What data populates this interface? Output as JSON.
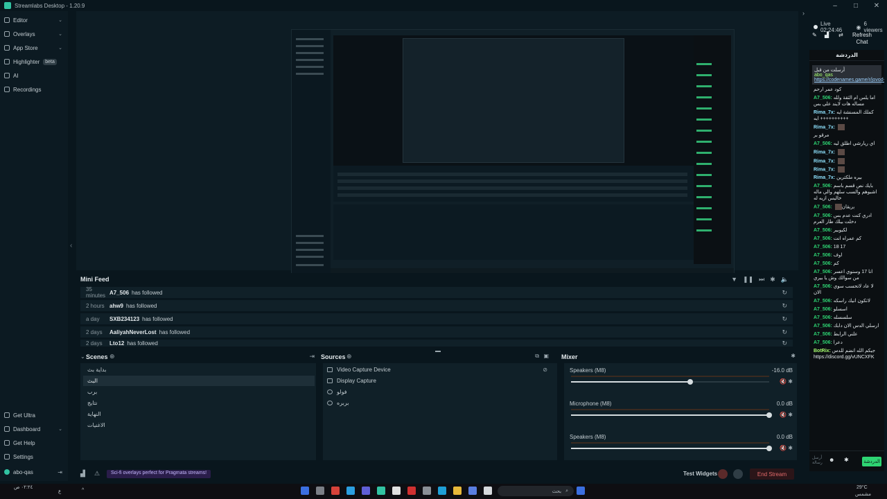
{
  "app": {
    "title": "Streamlabs Desktop - 1.20.9"
  },
  "sidebar": {
    "items": [
      {
        "label": "Editor",
        "chevron": "⌄"
      },
      {
        "label": "Overlays",
        "chevron": "⌄"
      },
      {
        "label": "App Store",
        "chevron": "⌄"
      },
      {
        "label": "Highlighter",
        "badge": "beta"
      },
      {
        "label": "AI"
      },
      {
        "label": "Recordings"
      }
    ],
    "bottom": [
      {
        "label": "Get Ultra"
      },
      {
        "label": "Dashboard",
        "chevron": "⌄"
      },
      {
        "label": "Get Help"
      },
      {
        "label": "Settings"
      }
    ],
    "user": {
      "name": "abo-qas"
    }
  },
  "mini_feed": {
    "title": "Mini Feed",
    "rows": [
      {
        "time": "35 minutes",
        "name": "A7_506",
        "action": "has followed"
      },
      {
        "time": "2 hours",
        "name": "ahw9",
        "action": "has followed"
      },
      {
        "time": "a day",
        "name": "SXB234123",
        "action": "has followed"
      },
      {
        "time": "2 days",
        "name": "AaliyahNeverLost",
        "action": "has followed"
      },
      {
        "time": "2 days",
        "name": "Lto12",
        "action": "has followed"
      }
    ]
  },
  "scenes": {
    "title": "Scenes",
    "items": [
      "بداية بث",
      "البث",
      "برب",
      "نتايج",
      "النهاية",
      "الاغنيات"
    ],
    "active_index": 1
  },
  "sources": {
    "title": "Sources",
    "items": [
      {
        "label": "Video Capture Device",
        "icon": "camera-icon"
      },
      {
        "label": "Display Capture",
        "icon": "monitor-icon"
      },
      {
        "label": "فولو",
        "icon": "globe-icon"
      },
      {
        "label": "بربره",
        "icon": "globe-icon"
      }
    ]
  },
  "mixer": {
    "title": "Mixer",
    "channels": [
      {
        "name": "Speakers (M8)",
        "db": "-16.0 dB",
        "level": 0.6
      },
      {
        "name": "Microphone (M8)",
        "db": "0.0 dB",
        "level": 1.0
      },
      {
        "name": "Speakers (M8)",
        "db": "0.0 dB",
        "level": 1.0
      }
    ]
  },
  "footer": {
    "alert": "Sci-fi overlays perfect for Pragmata streams!",
    "test_widgets": "Test Widgets",
    "end_stream": "End Stream"
  },
  "chat": {
    "live_time": "Live 02:24:46",
    "viewers": "6 viewers",
    "refresh": "Refresh Chat",
    "header": "الدردشة",
    "pinned_user": "abo_qas",
    "pinned_text": "أرسلت من قبل",
    "pinned_link": "https://codenames.game/r/jovod-...",
    "messages": [
      {
        "user": "",
        "text": "كود عمر ارحم"
      },
      {
        "user": "A7_506:",
        "text": "اما يلس ام الثقة ولله مساله هات لايند على بس",
        "cls": ""
      },
      {
        "user": "Rima_7x:",
        "text": "كملك المسنشة ايه ايه ++++++++++",
        "cls": "r"
      },
      {
        "user": "Rima_7x:",
        "text": "",
        "cls": "r",
        "emote": true
      },
      {
        "user": "",
        "text": "مرقو بر"
      },
      {
        "user": "A7_506:",
        "text": "اي ريارشي اطلق ليه",
        "cls": ""
      },
      {
        "user": "Rima_7x:",
        "text": "",
        "cls": "r",
        "emote": true
      },
      {
        "user": "Rima_7x:",
        "text": "",
        "cls": "r",
        "emote": true
      },
      {
        "user": "Rima_7x:",
        "text": "",
        "cls": "r",
        "emote": true
      },
      {
        "user": "Rima_7x:",
        "text": "بيره ملكترين",
        "cls": "r"
      },
      {
        "user": "A7_506:",
        "text": "بايك نص قسم باسم اشبوهم والسب سلهم والي ماله خاليس ازيه له",
        "cls": ""
      },
      {
        "user": "A7_506:",
        "text": "بربقان",
        "cls": "",
        "emote": true
      },
      {
        "user": "A7_506:",
        "text": "ادري كنت عدم بس دخلت بيلك طار العرم",
        "cls": ""
      },
      {
        "user": "A7_506:",
        "text": "لكيوبير",
        "cls": ""
      },
      {
        "user": "A7_506:",
        "text": "كم عمراه انت",
        "cls": ""
      },
      {
        "user": "A7_506:",
        "text": "18 17",
        "cls": ""
      },
      {
        "user": "A7_506:",
        "text": "اوف",
        "cls": ""
      },
      {
        "user": "A7_506:",
        "text": "كم",
        "cls": ""
      },
      {
        "user": "A7_506:",
        "text": "انا 17 وسنوي اعسر من سوالك وش يا بيري",
        "cls": ""
      },
      {
        "user": "A7_506:",
        "text": "لا عاد لاتحسب سوي الان",
        "cls": ""
      },
      {
        "user": "A7_506:",
        "text": "لاتكون انيك راسكه",
        "cls": ""
      },
      {
        "user": "A7_506:",
        "text": "اسسلو",
        "cls": ""
      },
      {
        "user": "A7_506:",
        "text": "سلسسله",
        "cls": ""
      },
      {
        "user": "A7_506:",
        "text": "ارسلي الدس الان دابك",
        "cls": ""
      },
      {
        "user": "A7_506:",
        "text": "علني الرابط",
        "cls": ""
      },
      {
        "user": "A7_506:",
        "text": "دعرا",
        "cls": ""
      },
      {
        "user": "BotRix:",
        "text": "جيكم الله انضم للدس https://discord.gg/vUNCXFK",
        "cls": "b"
      }
    ],
    "input_placeholder": "أرسل رسالة",
    "send_label": "الدردشة"
  },
  "taskbar": {
    "search_placeholder": "بحث",
    "weather": "29°C",
    "weather_desc": "مشمس",
    "lang": "ع"
  },
  "colors": {
    "accent": "#31c3a2",
    "chat_user": "#2ed573",
    "end_stream": "#e36b6b"
  }
}
